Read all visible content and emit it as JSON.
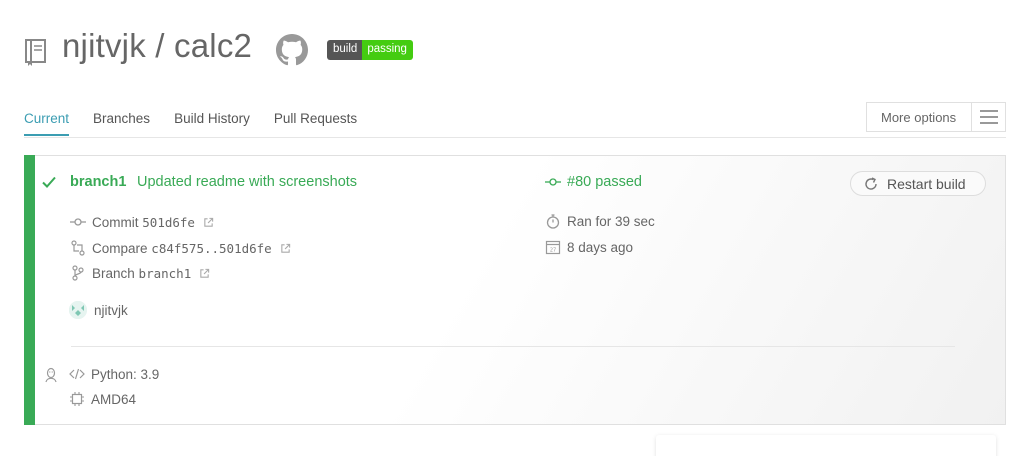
{
  "header": {
    "owner": "njitvjk",
    "separator": " / ",
    "repo": "calc2",
    "badge": {
      "label": "build",
      "status": "passing",
      "label_color": "#555555",
      "status_color": "#44cc11"
    }
  },
  "tabs": [
    {
      "label": "Current",
      "active": true
    },
    {
      "label": "Branches",
      "active": false
    },
    {
      "label": "Build History",
      "active": false
    },
    {
      "label": "Pull Requests",
      "active": false
    }
  ],
  "more_options": {
    "label": "More options",
    "icon": "hamburger-icon"
  },
  "build": {
    "status_color": "#39aa56",
    "branch": "branch1",
    "message": "Updated readme with screenshots",
    "number": "#80 passed",
    "commit": {
      "label": "Commit",
      "sha": "501d6fe"
    },
    "compare": {
      "label": "Compare",
      "range": "c84f575..501d6fe"
    },
    "branch_row": {
      "label": "Branch",
      "name": "branch1"
    },
    "duration": "Ran for 39 sec",
    "date": "8 days ago",
    "restart_label": "Restart build",
    "author": "njitvjk",
    "language": "Python: 3.9",
    "arch": "AMD64"
  }
}
